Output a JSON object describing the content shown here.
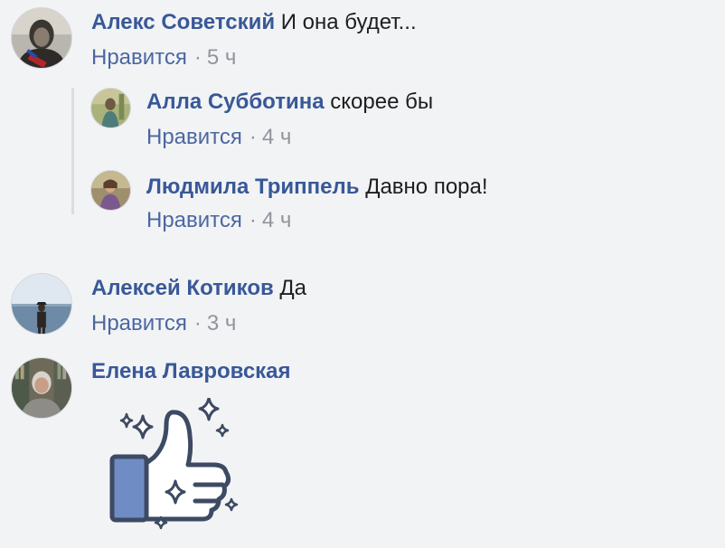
{
  "comments": [
    {
      "author": "Алекс Советский",
      "text": "И она будет...",
      "like_label": "Нравится",
      "separator": "·",
      "time": "5 ч"
    },
    {
      "author": "Алла Субботина",
      "text": "скорее бы",
      "like_label": "Нравится",
      "separator": "·",
      "time": "4 ч"
    },
    {
      "author": "Людмила Триппель",
      "text": "Давно пора!",
      "like_label": "Нравится",
      "separator": "·",
      "time": "4 ч"
    },
    {
      "author": "Алексей Котиков",
      "text": "Да",
      "like_label": "Нравится",
      "separator": "·",
      "time": "3 ч"
    },
    {
      "author": "Елена Лавровская",
      "sticker": "thumbs-up-sparkle-sticker"
    }
  ],
  "colors": {
    "author": "#385898",
    "like": "#4b67a1",
    "meta": "#90949c",
    "text": "#1c1e21",
    "background": "#f2f3f5",
    "sticker_blue": "#6f8cc4",
    "sticker_outline": "#3d4a63"
  }
}
